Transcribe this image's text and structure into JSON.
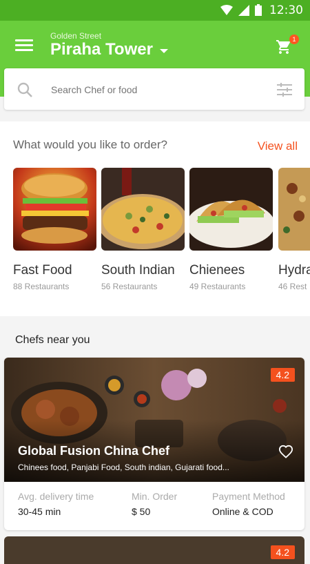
{
  "status": {
    "time": "12:30"
  },
  "header": {
    "subtitle": "Golden Street",
    "title": "Piraha Tower",
    "cart_count": "1"
  },
  "search": {
    "placeholder": "Search Chef or food"
  },
  "order": {
    "title": "What would you like to order?",
    "view_all": "View all",
    "categories": [
      {
        "name": "Fast Food",
        "count": "88 Restaurants"
      },
      {
        "name": "South Indian",
        "count": "56 Restaurants"
      },
      {
        "name": "Chienees",
        "count": "49 Restaurants"
      },
      {
        "name": "Hydra",
        "count": "46 Rest"
      }
    ]
  },
  "chefs": {
    "title": "Chefs near you",
    "items": [
      {
        "rating": "4.2",
        "name": "Global Fusion China Chef",
        "cuisine": "Chinees food, Panjabi Food, South indian, Gujarati food...",
        "delivery_label": "Avg. delivery time",
        "delivery_value": "30-45 min",
        "min_label": "Min. Order",
        "min_value": "$ 50",
        "payment_label": "Payment Method",
        "payment_value": "Online & COD"
      },
      {
        "rating": "4.2"
      }
    ]
  },
  "colors": {
    "primary": "#6ace3c",
    "statusbar": "#4caf23",
    "accent": "#f4511e"
  }
}
